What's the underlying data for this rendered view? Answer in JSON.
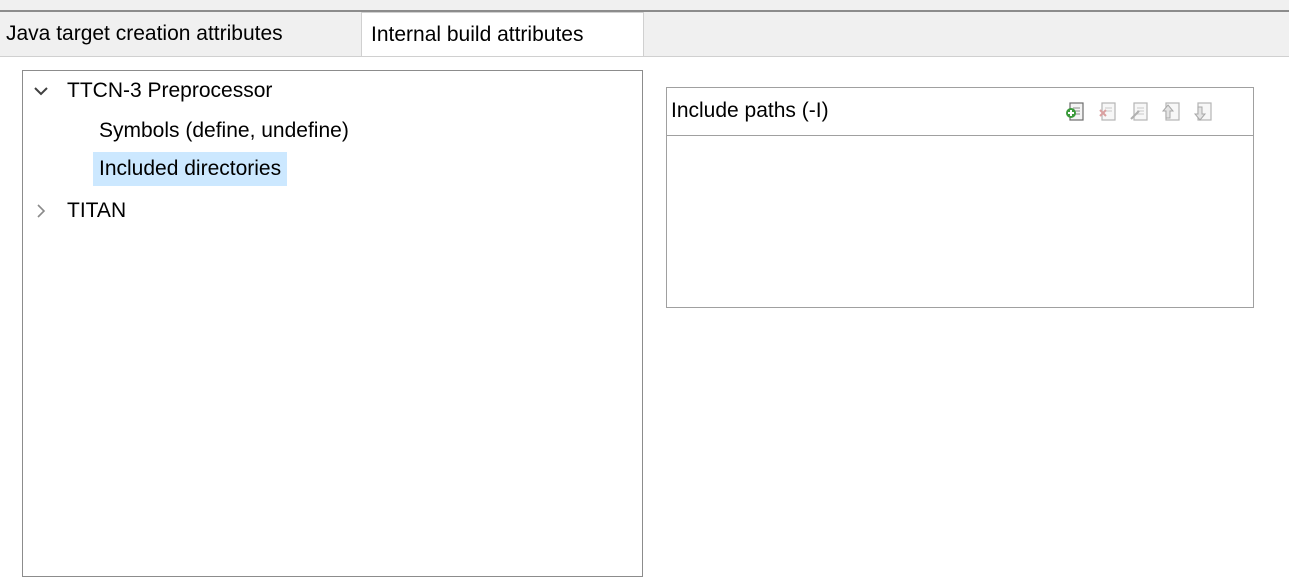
{
  "tabs": {
    "java_target": "Java target creation attributes",
    "internal_build": "Internal build attributes",
    "active": "internal_build"
  },
  "tree": {
    "items": [
      {
        "label": "TTCN-3 Preprocessor",
        "expanded": true,
        "children": [
          {
            "label": "Symbols (define, undefine)"
          },
          {
            "label": "Included directories",
            "selected": true
          }
        ]
      },
      {
        "label": "TITAN",
        "expanded": false
      }
    ]
  },
  "include_paths": {
    "title": "Include paths (-I)",
    "toolbar": {
      "add": "add-icon",
      "delete": "delete-icon",
      "edit": "edit-icon",
      "move_up": "move-up-icon",
      "move_down": "move-down-icon"
    },
    "entries": []
  },
  "colors": {
    "selection": "#cce8ff",
    "add_icon_green": "#3a9a3a",
    "disabled_icon": "#b0b0b0"
  }
}
